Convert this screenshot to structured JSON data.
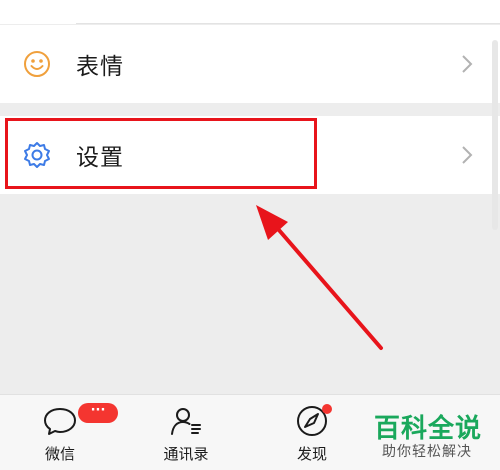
{
  "list": {
    "items": [
      {
        "label": "表情",
        "icon": "smiley-icon"
      },
      {
        "label": "设置",
        "icon": "gear-icon"
      }
    ]
  },
  "tabbar": {
    "tabs": [
      {
        "label": "微信",
        "icon": "chat-bubble-icon",
        "badge": "···"
      },
      {
        "label": "通讯录",
        "icon": "contacts-icon"
      },
      {
        "label": "发现",
        "icon": "compass-icon"
      }
    ]
  },
  "watermark": {
    "title": "百科全说",
    "subtitle": "助你轻松解决"
  },
  "colors": {
    "accent_orange": "#f0a03c",
    "accent_blue": "#3d7be6",
    "highlight_red": "#e8141b",
    "badge_red": "#f43530",
    "brand_green": "#1aa85c"
  }
}
